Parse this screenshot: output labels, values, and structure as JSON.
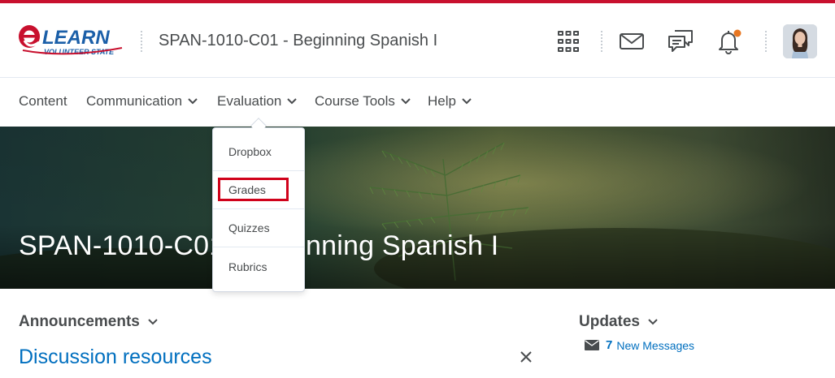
{
  "header": {
    "logo_text": "eLEARN",
    "logo_subtext": "VOLUNTEER STATE",
    "course_title": "SPAN-1010-C01 - Beginning Spanish I",
    "icons": [
      "apps-grid-icon",
      "mail-icon",
      "chat-icon",
      "bell-icon"
    ],
    "notification_dot_color": "#e87722"
  },
  "nav": {
    "items": [
      {
        "label": "Content",
        "has_menu": false
      },
      {
        "label": "Communication",
        "has_menu": true
      },
      {
        "label": "Evaluation",
        "has_menu": true
      },
      {
        "label": "Course Tools",
        "has_menu": true
      },
      {
        "label": "Help",
        "has_menu": true
      }
    ]
  },
  "dropdown": {
    "items": [
      {
        "label": "Dropbox"
      },
      {
        "label": "Grades",
        "highlighted": true
      },
      {
        "label": "Quizzes"
      },
      {
        "label": "Rubrics"
      }
    ],
    "highlight_color": "#d0021b"
  },
  "banner": {
    "title": "SPAN-1010-C01 - Beginning Spanish I"
  },
  "announcements": {
    "title": "Announcements",
    "item_title": "Discussion resources"
  },
  "updates": {
    "title": "Updates",
    "count": "7",
    "label": "New Messages"
  },
  "colors": {
    "brand_red": "#c8102e",
    "link_blue": "#006fbf",
    "text_gray": "#494c4e"
  }
}
